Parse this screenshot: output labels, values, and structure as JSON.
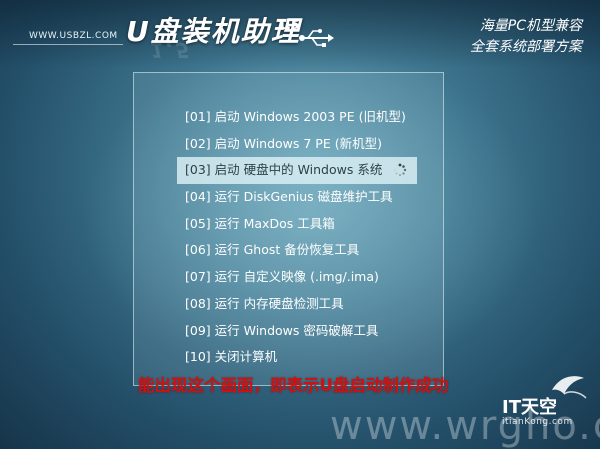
{
  "header": {
    "site": "WWW.USBZL.COM",
    "logo": "U盘装机助理",
    "version": "1.5",
    "tagline_line1": "海量PC机型兼容",
    "tagline_line2": "全套系统部署方案"
  },
  "menu": {
    "items": [
      {
        "label": "[01] 启动 Windows 2003 PE (旧机型)",
        "selected": false
      },
      {
        "label": "[02] 启动 Windows 7 PE (新机型)",
        "selected": false
      },
      {
        "label": "[03] 启动 硬盘中的 Windows 系统",
        "selected": true
      },
      {
        "label": "[04] 运行 DiskGenius 磁盘维护工具",
        "selected": false
      },
      {
        "label": "[05] 运行 MaxDos 工具箱",
        "selected": false
      },
      {
        "label": "[06] 运行 Ghost 备份恢复工具",
        "selected": false
      },
      {
        "label": "[07] 运行 自定义映像 (.img/.ima)",
        "selected": false
      },
      {
        "label": "[08] 运行 内存硬盘检测工具",
        "selected": false
      },
      {
        "label": "[09] 运行 Windows 密码破解工具",
        "selected": false
      },
      {
        "label": "[10] 关闭计算机",
        "selected": false
      }
    ]
  },
  "notice": "能出现这个画面，即表示U盘启动制作成功",
  "watermark": "www.wrgho.com",
  "brand": {
    "name": "IT天空",
    "sub": "itianKong.com"
  },
  "colors": {
    "notice": "#d40f0f",
    "selected_bg": "#dcf0f5",
    "background": "#3f7790"
  }
}
